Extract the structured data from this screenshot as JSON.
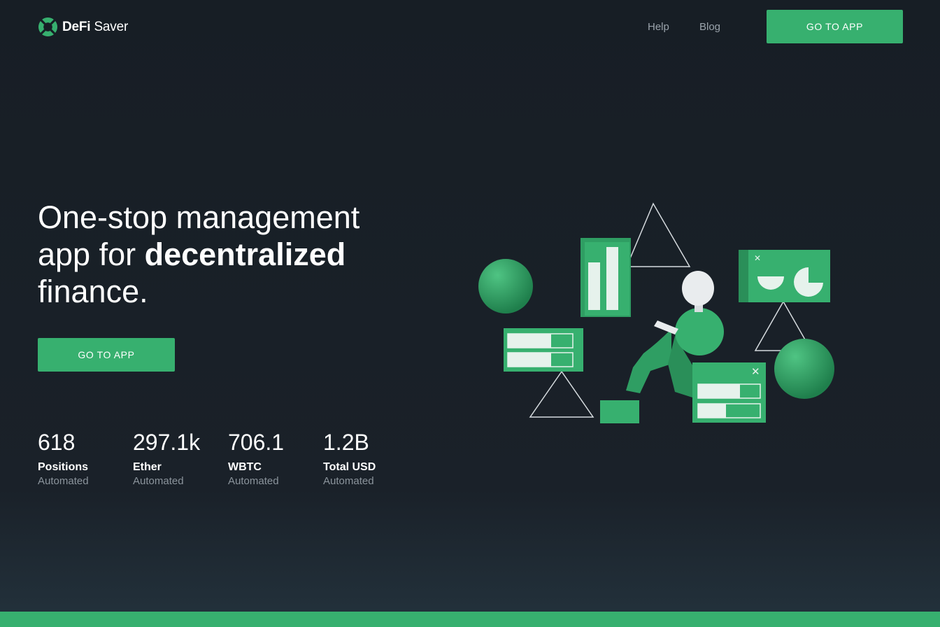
{
  "brand": {
    "name_bold": "DeFi",
    "name_rest": " Saver"
  },
  "nav": {
    "help": "Help",
    "blog": "Blog",
    "cta": "GO TO APP"
  },
  "hero": {
    "line1": "One-stop management",
    "line2_prefix": "app for ",
    "line2_bold": "decentralized",
    "line3": "finance.",
    "cta": "GO TO APP"
  },
  "stats": [
    {
      "value": "618",
      "label": "Positions",
      "sub": "Automated"
    },
    {
      "value": "297.1k",
      "label": "Ether",
      "sub": "Automated"
    },
    {
      "value": "706.1",
      "label": "WBTC",
      "sub": "Automated"
    },
    {
      "value": "1.2B",
      "label": "Total USD",
      "sub": "Automated"
    }
  ],
  "colors": {
    "accent": "#37b06f",
    "background": "#171e25",
    "muted": "#8b949c"
  },
  "icons": {
    "logo": "lifebuoy-logo-icon"
  }
}
